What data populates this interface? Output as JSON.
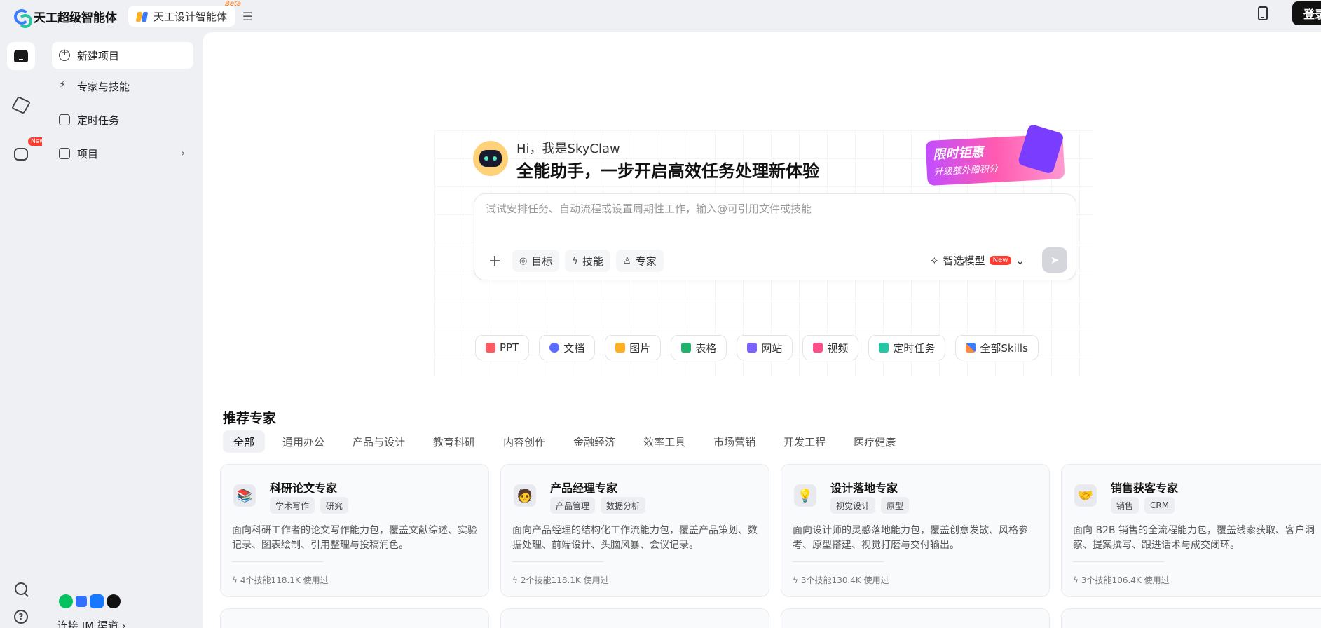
{
  "topbar": {
    "brand": "天工超级智能体",
    "tab_label": "天工设计智能体",
    "tab_badge": "Beta",
    "menu_glyph": "☰",
    "login": "登录"
  },
  "rail": {
    "new_badge": "New",
    "help_glyph": "?"
  },
  "sidenav": {
    "items": [
      {
        "label": "新建项目"
      },
      {
        "label": "专家与技能"
      },
      {
        "label": "定时任务"
      },
      {
        "label": "项目"
      }
    ],
    "chevron": "›",
    "im_label": "连接 IM 渠道 ›"
  },
  "hero": {
    "hi": "Hi，我是SkyClaw",
    "headline": "全能助手，一步开启高效任务处理新体验",
    "promo_line1": "限时钜惠",
    "promo_line2": "升级额外赠积分"
  },
  "composer": {
    "placeholder": "试试安排任务、自动流程或设置周期性工作，输入@可引用文件或技能",
    "plus": "+",
    "tools": [
      {
        "label": "目标"
      },
      {
        "label": "技能"
      },
      {
        "label": "专家"
      }
    ],
    "model_label": "智选模型",
    "model_badge": "New",
    "model_chevron": "⌄",
    "send_glyph": "➤"
  },
  "quick": [
    {
      "label": "PPT",
      "color": "#ff5a5f"
    },
    {
      "label": "文档",
      "color": "#5b6cff"
    },
    {
      "label": "图片",
      "color": "#ffb020"
    },
    {
      "label": "表格",
      "color": "#20b26b"
    },
    {
      "label": "网站",
      "color": "#7b61ff"
    },
    {
      "label": "视频",
      "color": "#ff4d8d"
    },
    {
      "label": "定时任务",
      "color": "#26c6a4"
    },
    {
      "label": "全部Skills",
      "color": "#ff8a3d"
    }
  ],
  "experts": {
    "title": "推荐专家",
    "categories": [
      "全部",
      "通用办公",
      "产品与设计",
      "教育科研",
      "内容创作",
      "金融经济",
      "效率工具",
      "市场营销",
      "开发工程",
      "医疗健康"
    ],
    "cards": [
      {
        "title": "科研论文专家",
        "tags": [
          "学术写作",
          "研究"
        ],
        "desc": "面向科研工作者的论文写作能力包，覆盖文献综述、实验记录、图表绘制、引用整理与投稿润色。",
        "meta": "4个技能118.1K 使用过",
        "emoji": "📚"
      },
      {
        "title": "产品经理专家",
        "tags": [
          "产品管理",
          "数据分析"
        ],
        "desc": "面向产品经理的结构化工作流能力包，覆盖产品策划、数据处理、前端设计、头脑风暴、会议记录。",
        "meta": "2个技能118.1K 使用过",
        "emoji": "🧑"
      },
      {
        "title": "设计落地专家",
        "tags": [
          "视觉设计",
          "原型"
        ],
        "desc": "面向设计师的灵感落地能力包，覆盖创意发散、风格参考、原型搭建、视觉打磨与交付输出。",
        "meta": "3个技能130.4K 使用过",
        "emoji": "💡"
      },
      {
        "title": "销售获客专家",
        "tags": [
          "销售",
          "CRM"
        ],
        "desc": "面向 B2B 销售的全流程能力包，覆盖线索获取、客户洞察、提案撰写、跟进话术与成交闭环。",
        "meta": "3个技能106.4K 使用过",
        "emoji": "🤝"
      }
    ]
  }
}
